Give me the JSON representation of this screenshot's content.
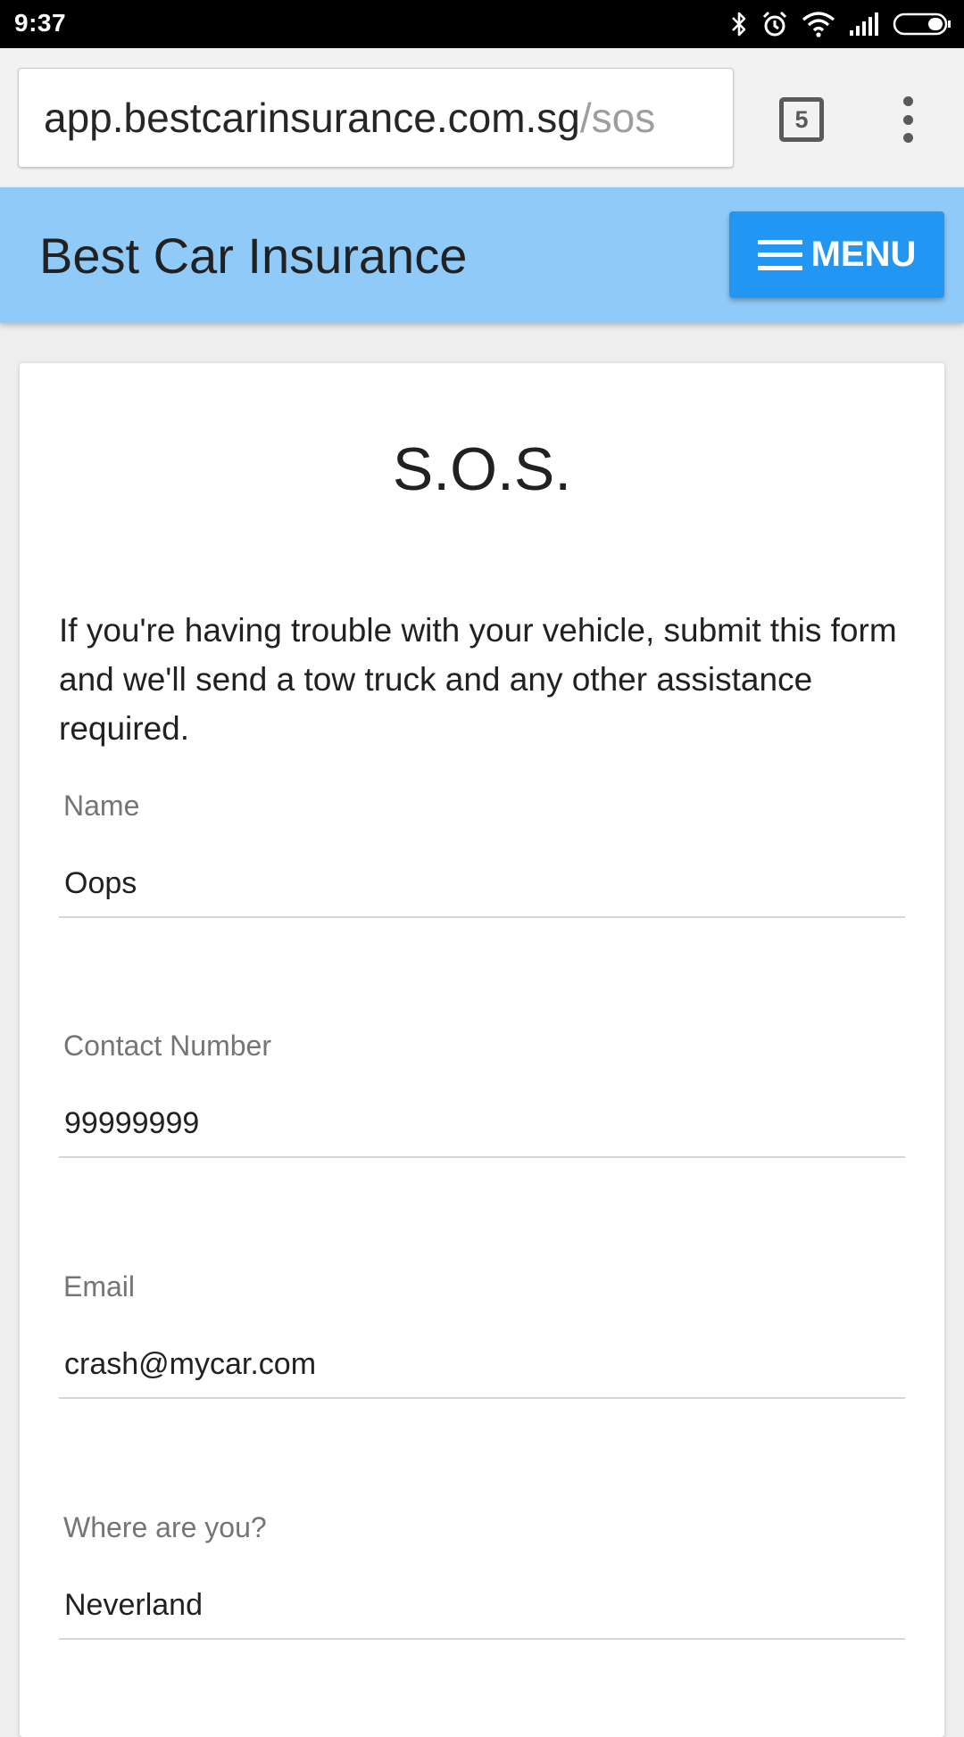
{
  "status_bar": {
    "time": "9:37",
    "icons": [
      "bluetooth-icon",
      "alarm-icon",
      "wifi-icon",
      "signal-icon",
      "battery-icon"
    ]
  },
  "browser": {
    "url_host": "app.bestcarinsurance.com.sg",
    "url_path": "/sos",
    "tab_count": "5"
  },
  "header": {
    "title": "Best Car Insurance",
    "menu_label": "MENU",
    "background": "#90caf9",
    "menu_color": "#2196f3"
  },
  "page": {
    "title": "S.O.S.",
    "intro": "If you're having trouble with your vehicle, submit this form and we'll send a tow truck and any other assistance required."
  },
  "form": {
    "name": {
      "label": "Name",
      "value": "Oops"
    },
    "contact": {
      "label": "Contact Number",
      "value": "99999999"
    },
    "email": {
      "label": "Email",
      "value": "crash@mycar.com"
    },
    "location": {
      "label": "Where are you?",
      "value": "Neverland"
    }
  }
}
